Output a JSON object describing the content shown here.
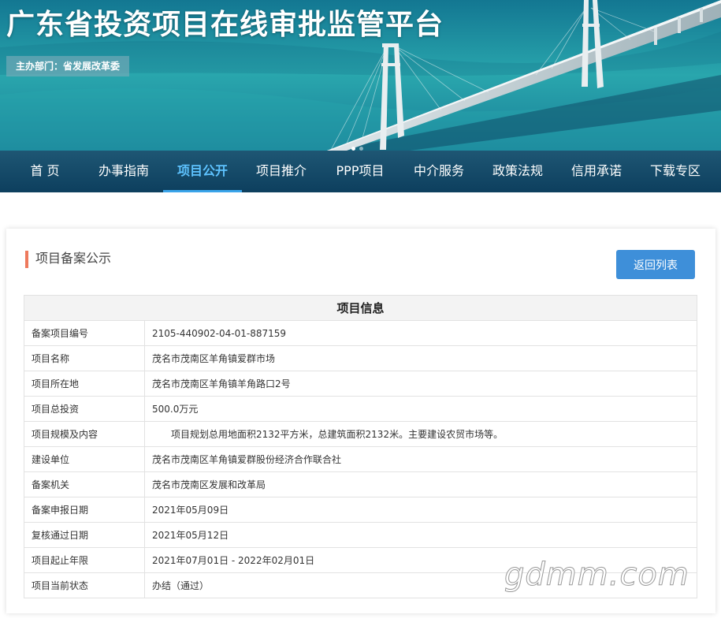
{
  "header": {
    "site_title": "广东省投资项目在线审批监管平台",
    "host_badge": "主办部门：省发展改革委"
  },
  "nav": {
    "items": [
      {
        "label": "首 页"
      },
      {
        "label": "办事指南"
      },
      {
        "label": "项目公开"
      },
      {
        "label": "项目推介"
      },
      {
        "label": "PPP项目"
      },
      {
        "label": "中介服务"
      },
      {
        "label": "政策法规"
      },
      {
        "label": "信用承诺"
      },
      {
        "label": "下载专区"
      }
    ],
    "active_index": 2
  },
  "section": {
    "title": "项目备案公示",
    "back_button": "返回列表"
  },
  "table": {
    "header": "项目信息",
    "rows": [
      {
        "label": "备案项目编号",
        "value": "2105-440902-04-01-887159"
      },
      {
        "label": "项目名称",
        "value": "茂名市茂南区羊角镇爱群市场"
      },
      {
        "label": "项目所在地",
        "value": "茂名市茂南区羊角镇羊角路口2号"
      },
      {
        "label": "项目总投资",
        "value": "500.0万元"
      },
      {
        "label": "项目规模及内容",
        "value": "项目规划总用地面积2132平方米，总建筑面积2132米。主要建设农贸市场等。"
      },
      {
        "label": "建设单位",
        "value": "茂名市茂南区羊角镇爱群股份经济合作联合社"
      },
      {
        "label": "备案机关",
        "value": "茂名市茂南区发展和改革局"
      },
      {
        "label": "备案申报日期",
        "value": "2021年05月09日"
      },
      {
        "label": "复核通过日期",
        "value": "2021年05月12日"
      },
      {
        "label": "项目起止年限",
        "value": "2021年07月01日 - 2022年02月01日"
      },
      {
        "label": "项目当前状态",
        "value": "办结（通过）"
      }
    ]
  },
  "watermark": "gdmm.com",
  "colors": {
    "nav_bg": "#0d3f5e",
    "nav_active": "#5ec3ff",
    "accent_bar": "#ee7a5d",
    "button": "#3e8fd9"
  }
}
